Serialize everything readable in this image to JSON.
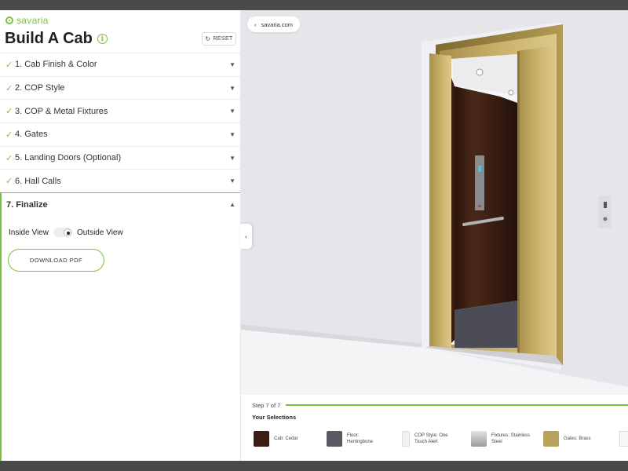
{
  "brand": {
    "name": "savaria"
  },
  "header": {
    "title": "Build A Cab",
    "reset_label": "RESET"
  },
  "steps": [
    {
      "label": "1. Cab Finish & Color",
      "completed": true
    },
    {
      "label": "2. COP Style",
      "completed": true
    },
    {
      "label": "3. COP & Metal Fixtures",
      "completed": true
    },
    {
      "label": "4. Gates",
      "completed": true
    },
    {
      "label": "5. Landing Doors (Optional)",
      "completed": true
    },
    {
      "label": "6. Hall Calls",
      "completed": true
    },
    {
      "label": "7. Finalize",
      "completed": false,
      "active": true
    }
  ],
  "finalize": {
    "inside_label": "Inside View",
    "outside_label": "Outside View",
    "view_selected": "Outside View",
    "download_label": "DOWNLOAD PDF"
  },
  "viewer": {
    "back_link": "savaria.com"
  },
  "footer": {
    "step_text": "Step 7 of 7",
    "progress": 1.0,
    "selections_title": "Your Selections",
    "selections": [
      {
        "label": "Cab: Cedar",
        "color": "#3d1d12"
      },
      {
        "label": "Floor: Herringbone",
        "color": "#5a5a62"
      },
      {
        "label": "COP Style: One Touch Alert",
        "color": "#f2f2f2"
      },
      {
        "label": "Fixtures: Stainless Steel",
        "color": "#b9b9b9"
      },
      {
        "label": "Gates: Brass",
        "color": "#b6a45e"
      }
    ]
  },
  "colors": {
    "accent": "#7bc142"
  },
  "icons": {
    "check": "check-icon",
    "chevron": "chevron-down-icon",
    "info": "info-icon",
    "reset": "reset-icon",
    "back": "chevron-left-icon"
  }
}
